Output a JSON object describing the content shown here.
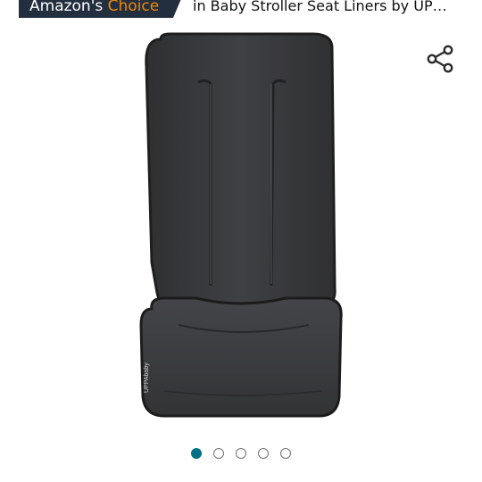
{
  "badge": {
    "prefix": "Amazon's",
    "highlight": "Choice",
    "subtitle": "in Baby Stroller Seat Liners by UP…"
  },
  "icons": {
    "share": "share-icon"
  },
  "product_image": {
    "brand_print": "UPPAbaby",
    "fabric_color": "#3b3c3e"
  },
  "carousel": {
    "total": 5,
    "active_index": 0
  },
  "colors": {
    "badge_bg": "#232f3e",
    "badge_accent": "#f08804",
    "active_dot": "#007185"
  }
}
